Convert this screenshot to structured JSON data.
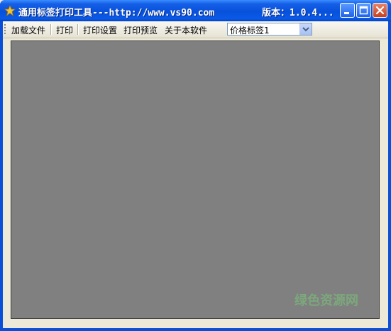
{
  "window": {
    "title": "通用标签打印工具---http://www.vs90.com",
    "version": "版本：1.0.4...",
    "icons": {
      "app": "star-icon",
      "minimize": "minimize-icon",
      "maximize": "maximize-icon",
      "close": "close-icon"
    },
    "colors": {
      "titlebar": "#0751DB",
      "canvas": "#808080",
      "face": "#ECE9D8"
    }
  },
  "toolbar": {
    "items": [
      {
        "label": "加载文件"
      },
      {
        "label": "打印"
      },
      {
        "label": "打印设置"
      },
      {
        "label": "打印预览"
      },
      {
        "label": "关于本软件"
      }
    ],
    "template_select": {
      "value": "价格标签1"
    }
  },
  "watermark": {
    "text": "绿色资源网"
  }
}
